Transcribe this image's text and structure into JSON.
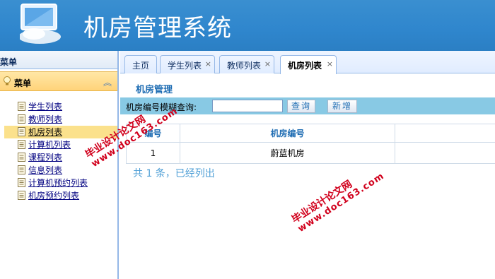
{
  "header": {
    "title": "机房管理系统",
    "logo_icon": "monitor-icon"
  },
  "sidebar": {
    "heading": "菜单",
    "panel_title": "菜单",
    "items": [
      {
        "label": "学生列表",
        "active": false
      },
      {
        "label": "教师列表",
        "active": false
      },
      {
        "label": "机房列表",
        "active": true
      },
      {
        "label": "计算机列表",
        "active": false
      },
      {
        "label": "课程列表",
        "active": false
      },
      {
        "label": "信息列表",
        "active": false
      },
      {
        "label": "计算机预约列表",
        "active": false
      },
      {
        "label": "机房预约列表",
        "active": false
      }
    ]
  },
  "tabs": [
    {
      "label": "主页",
      "closable": false,
      "active": false
    },
    {
      "label": "学生列表",
      "closable": true,
      "active": false
    },
    {
      "label": "教师列表",
      "closable": true,
      "active": false
    },
    {
      "label": "机房列表",
      "closable": true,
      "active": true
    }
  ],
  "tab_close_glyph": "×",
  "content": {
    "section_title": "机房管理",
    "search_label": "机房编号模糊查询:",
    "search_value": "",
    "query_button": "查询",
    "add_button": "新增",
    "table": {
      "columns": [
        "编号",
        "机房编号",
        ""
      ],
      "rows": [
        [
          "1",
          "蔚蓝机房",
          ""
        ]
      ]
    },
    "summary": "共 1 条，已经列出"
  },
  "watermarks": [
    {
      "cn": "毕业设计论文网",
      "url": "www.doc163.com"
    },
    {
      "cn": "毕业设计论文网",
      "url": "www.doc163.com"
    }
  ],
  "colors": {
    "header_blue": "#2f86cd",
    "toolbar_blue": "#88c9e4",
    "active_menu": "#fbe18c",
    "watermark_red": "#d1001c"
  }
}
